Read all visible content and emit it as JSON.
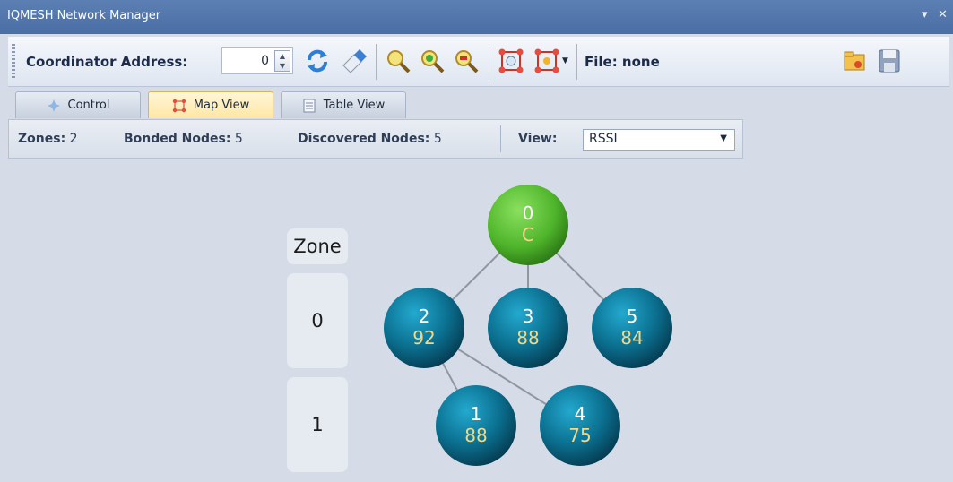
{
  "window": {
    "title": "IQMESH Network Manager",
    "pin_glyph": "▾",
    "close_glyph": "✕"
  },
  "toolbar": {
    "coordinator_label": "Coordinator Address:",
    "coordinator_value": "0",
    "file_label": "File: none",
    "buttons": [
      "refresh-icon",
      "eraser-icon",
      "zoom-fit-icon",
      "zoom-in-icon",
      "zoom-out-icon",
      "network-scan-icon",
      "network-options-icon",
      "open-folder-icon",
      "save-icon"
    ]
  },
  "tabs": [
    {
      "label": "Control",
      "active": false
    },
    {
      "label": "Map View",
      "active": true
    },
    {
      "label": "Table View",
      "active": false
    }
  ],
  "info": {
    "zones_label": "Zones:",
    "zones_value": "2",
    "bonded_label": "Bonded Nodes:",
    "bonded_value": "5",
    "discovered_label": "Discovered Nodes:",
    "discovered_value": "5",
    "view_label": "View:",
    "view_value": "RSSI"
  },
  "zones": {
    "header": "Zone",
    "items": [
      "0",
      "1"
    ]
  },
  "nodes": [
    {
      "id": "0",
      "value": "C",
      "kind": "coordinator",
      "zone": -1,
      "slot": 2
    },
    {
      "id": "2",
      "value": "92",
      "kind": "node",
      "zone": 0,
      "slot": 1
    },
    {
      "id": "3",
      "value": "88",
      "kind": "node",
      "zone": 0,
      "slot": 2
    },
    {
      "id": "5",
      "value": "84",
      "kind": "node",
      "zone": 0,
      "slot": 3
    },
    {
      "id": "1",
      "value": "88",
      "kind": "node",
      "zone": 1,
      "slot": 1.5
    },
    {
      "id": "4",
      "value": "75",
      "kind": "node",
      "zone": 1,
      "slot": 2.5
    }
  ],
  "links": [
    [
      "0",
      "2"
    ],
    [
      "0",
      "3"
    ],
    [
      "0",
      "5"
    ],
    [
      "2",
      "1"
    ],
    [
      "2",
      "4"
    ]
  ],
  "colors": {
    "coordinator": "#5cc43a",
    "node": "#0b6f8f",
    "node_value": "#f0d98a",
    "accent": "#ffe6a3"
  }
}
